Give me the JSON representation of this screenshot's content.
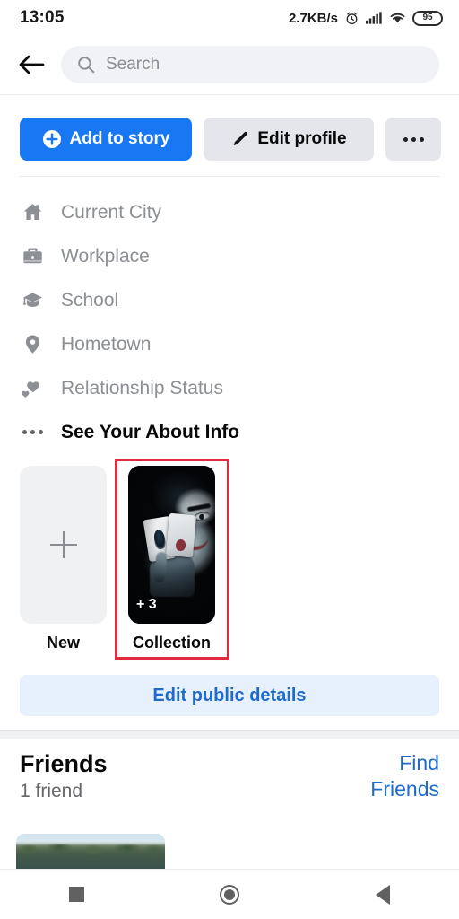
{
  "status_bar": {
    "time": "13:05",
    "network_speed": "2.7KB/s",
    "alarm_icon": "alarm-clock-icon",
    "signal_icon": "cellular-signal-icon",
    "wifi_icon": "wifi-icon",
    "battery_level": "95"
  },
  "header": {
    "back_icon": "back-arrow-icon",
    "search_icon": "search-icon",
    "search_value": "",
    "search_placeholder": "Search"
  },
  "actions": {
    "add_to_story_label": "Add to story",
    "add_to_story_icon": "plus-circle-icon",
    "edit_profile_label": "Edit profile",
    "edit_profile_icon": "pencil-icon",
    "more_icon": "ellipsis-icon"
  },
  "about": {
    "items": [
      {
        "label": "Current City",
        "icon": "home-icon"
      },
      {
        "label": "Workplace",
        "icon": "briefcase-icon"
      },
      {
        "label": "School",
        "icon": "graduation-cap-icon"
      },
      {
        "label": "Hometown",
        "icon": "location-pin-icon"
      },
      {
        "label": "Relationship Status",
        "icon": "hearts-icon"
      }
    ],
    "see_about_label": "See Your About Info",
    "see_about_icon": "ellipsis-icon"
  },
  "featured": {
    "new_card": {
      "label": "New",
      "icon": "plus-icon"
    },
    "collection_card": {
      "label": "Collection",
      "count_badge": "+ 3",
      "image": "joker-playing-card-photo"
    },
    "highlight_color": "#e02b3c"
  },
  "edit_public_details": {
    "label": "Edit public details"
  },
  "friends": {
    "title": "Friends",
    "subtitle": "1 friend",
    "find_friends_line1": "Find",
    "find_friends_line2": "Friends",
    "thumbnail": "forest-landscape-photo"
  },
  "nav_bar": {
    "recents_icon": "square-recents-icon",
    "home_icon": "circle-home-icon",
    "back_icon": "triangle-back-icon"
  },
  "colors": {
    "brand_blue": "#1877f2",
    "link_blue": "#1f6bcc",
    "light_blue_bg": "#e7f0fd",
    "chip_gray": "#e4e6eb",
    "muted_text": "#8c8f94"
  }
}
